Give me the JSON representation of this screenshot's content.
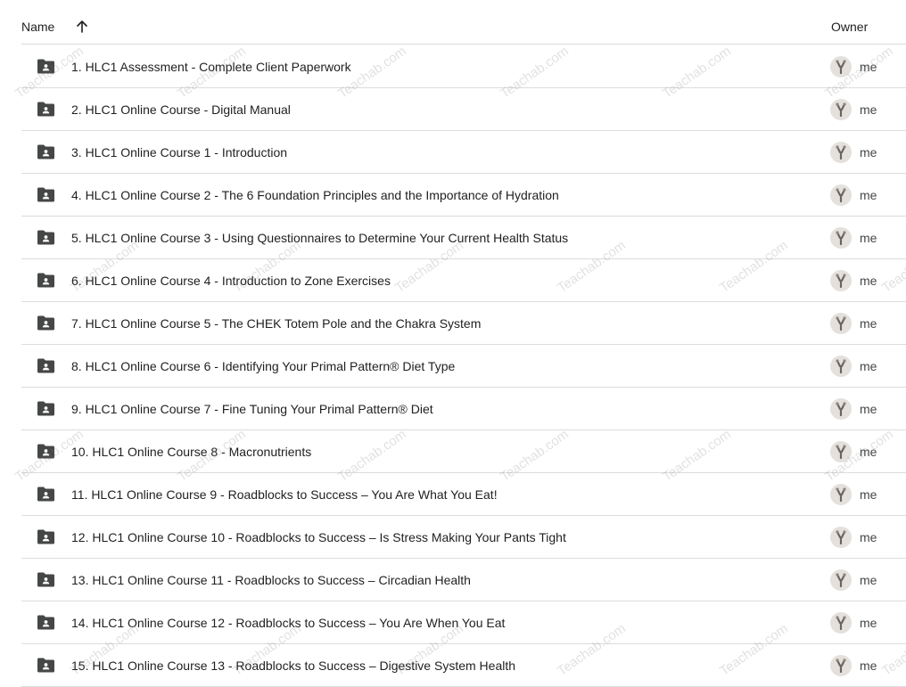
{
  "header": {
    "name_label": "Name",
    "owner_label": "Owner"
  },
  "watermark": "Teachab.com",
  "files": [
    {
      "name": "1. HLC1 Assessment - Complete Client Paperwork",
      "owner": "me"
    },
    {
      "name": "2. HLC1 Online Course - Digital Manual",
      "owner": "me"
    },
    {
      "name": "3. HLC1 Online Course 1 - Introduction",
      "owner": "me"
    },
    {
      "name": "4. HLC1 Online Course 2 - The 6 Foundation Principles and the Importance of Hydration",
      "owner": "me"
    },
    {
      "name": "5. HLC1 Online Course 3 - Using Questionnaires to Determine Your Current Health Status",
      "owner": "me"
    },
    {
      "name": "6. HLC1 Online Course 4 - Introduction to Zone Exercises",
      "owner": "me"
    },
    {
      "name": "7. HLC1 Online Course 5 - The CHEK Totem Pole and the Chakra System",
      "owner": "me"
    },
    {
      "name": "8. HLC1 Online Course 6 - Identifying Your Primal Pattern® Diet Type",
      "owner": "me"
    },
    {
      "name": "9. HLC1 Online Course 7 - Fine Tuning Your Primal Pattern® Diet",
      "owner": "me"
    },
    {
      "name": "10. HLC1 Online Course 8 - Macronutrients",
      "owner": "me"
    },
    {
      "name": "11. HLC1 Online Course 9 - Roadblocks to Success – You Are What You Eat!",
      "owner": "me"
    },
    {
      "name": "12. HLC1 Online Course 10 - Roadblocks to Success – Is Stress Making Your Pants Tight",
      "owner": "me"
    },
    {
      "name": "13. HLC1 Online Course 11 - Roadblocks to Success – Circadian Health",
      "owner": "me"
    },
    {
      "name": "14. HLC1 Online Course 12 - Roadblocks to Success – You Are When You Eat",
      "owner": "me"
    },
    {
      "name": "15. HLC1 Online Course 13 - Roadblocks to Success – Digestive System Health",
      "owner": "me"
    }
  ],
  "colors": {
    "icon": "#444746",
    "divider": "#dadce0",
    "text": "#1f1f1f",
    "watermark": "#787878"
  },
  "icons": {
    "sort": "arrow-up-icon",
    "folder": "shared-folder-icon",
    "avatar": "owner-avatar-icon"
  }
}
